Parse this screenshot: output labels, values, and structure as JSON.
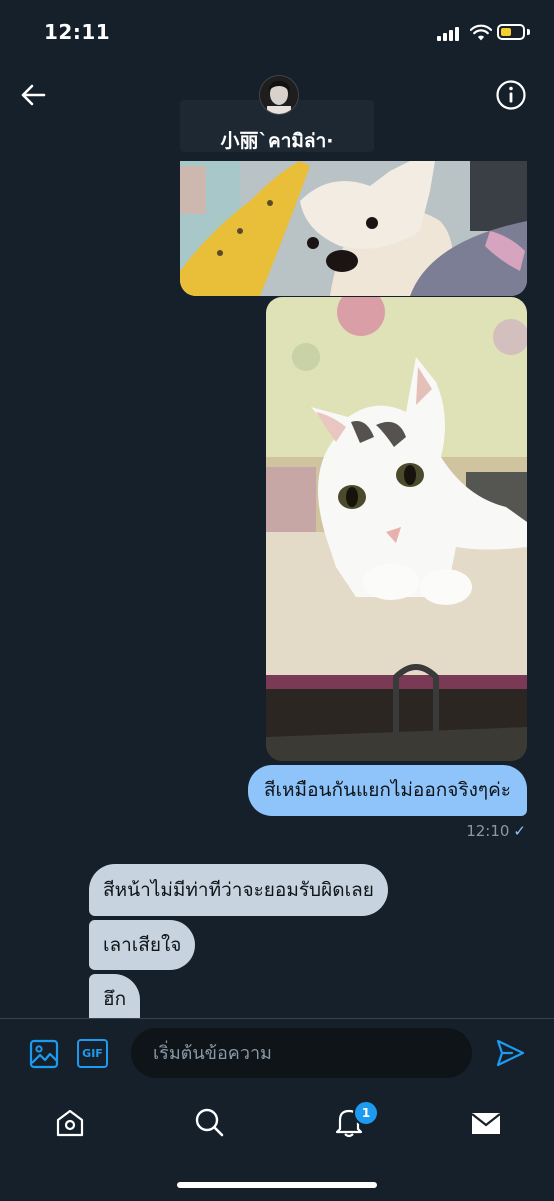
{
  "status_bar": {
    "time": "12:11",
    "battery_level": 0.5
  },
  "header": {
    "contact_name": "小丽`คามิล่า·"
  },
  "icons": {
    "back": "arrow-left-icon",
    "info": "info-circle-icon",
    "photo": "photo-icon",
    "gif_label": "GIF",
    "send": "send-icon",
    "home": "home-icon",
    "search": "search-icon",
    "notifications": "bell-icon",
    "messages": "envelope-icon"
  },
  "messages": {
    "outgoing_text": "สีเหมือนกันแยกไม่ออกจริงๆค่ะ",
    "timestamp": "12:10",
    "read_mark": "✓",
    "incoming": [
      "สีหน้าไม่มีท่าทีว่าจะยอมรับผิดเลย",
      "เลาเสียใจ",
      "ฮึก"
    ]
  },
  "composer": {
    "placeholder": "เริ่มต้นข้อความ"
  },
  "tab_bar": {
    "notification_count": "1"
  },
  "colors": {
    "background": "#15202b",
    "accent": "#1d9bf0",
    "outgoing_bubble": "#8fc4fa",
    "incoming_bubble": "#c7d3de"
  }
}
